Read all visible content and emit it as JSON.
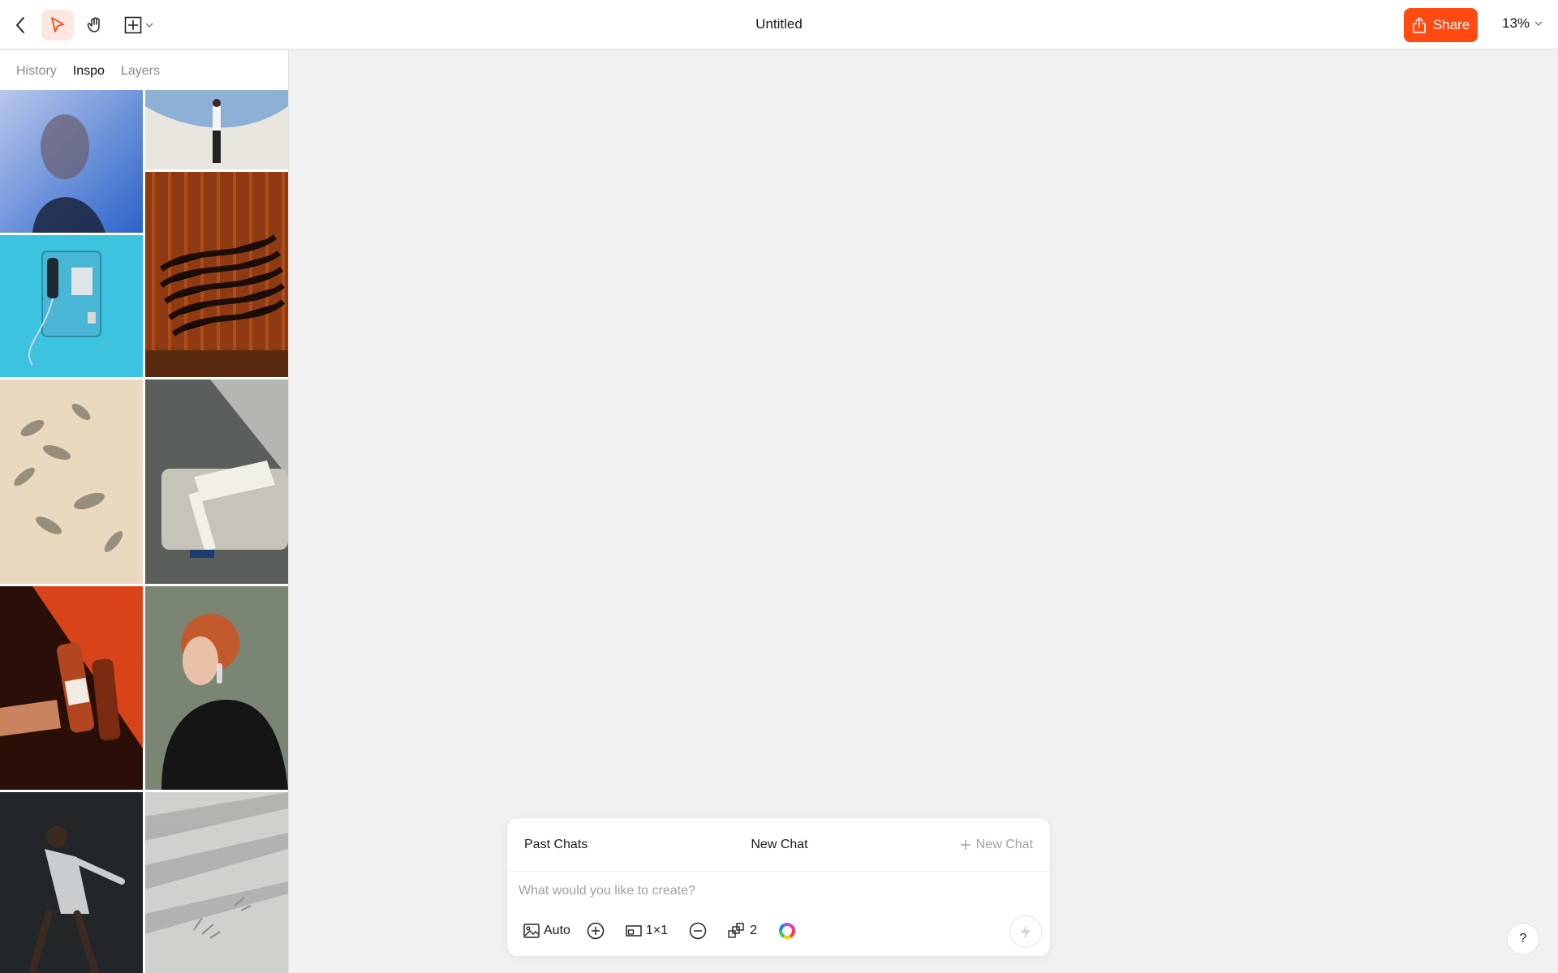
{
  "topbar": {
    "title": "Untitled",
    "share_label": "Share",
    "zoom": "13%",
    "icons": [
      "chevron-left-icon",
      "cursor-select-icon",
      "hand-icon",
      "add-frame-icon",
      "chevron-down-icon",
      "share-icon"
    ],
    "accent_color": "#ff4a12",
    "selected_tool_bg": "#fde7e1"
  },
  "sidebar": {
    "tabs": [
      {
        "label": "History",
        "active": false
      },
      {
        "label": "Inspo",
        "active": true
      },
      {
        "label": "Layers",
        "active": false
      }
    ],
    "inspo_images": [
      "blurred woman portrait in blue",
      "man standing on white curved wall under sky",
      "orange and black striped fabric on chair",
      "blue payphone on blue wall",
      "leaf shadows on beige wall",
      "person in white pants reclining on sofa",
      "hand holding bottles against orange tiles",
      "red-haired woman in black coat",
      "man running in white outfit",
      "handprints in sunlit sand shadows"
    ]
  },
  "chat": {
    "past_chats_label": "Past Chats",
    "title": "New Chat",
    "new_chat_label": "New Chat",
    "input_placeholder": "What would you like to create?",
    "tools": {
      "image_mode": "Auto",
      "aspect_ratio": "1×1",
      "count": "2"
    }
  },
  "help_label": "?"
}
